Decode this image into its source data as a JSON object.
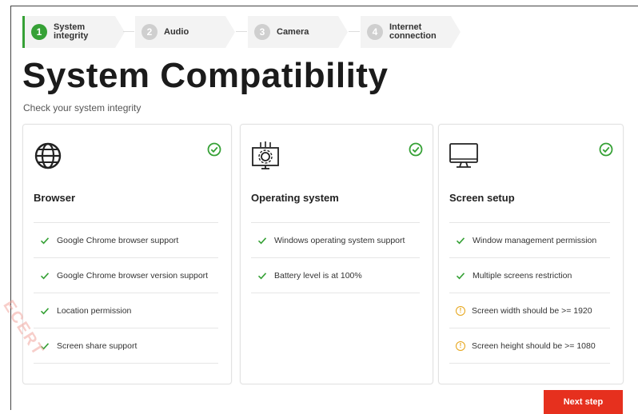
{
  "stepper": {
    "steps": [
      {
        "number": "1",
        "label": "System integrity",
        "active": true
      },
      {
        "number": "2",
        "label": "Audio",
        "active": false
      },
      {
        "number": "3",
        "label": "Camera",
        "active": false
      },
      {
        "number": "4",
        "label": "Internet connection",
        "active": false
      }
    ]
  },
  "page": {
    "title": "System Compatibility",
    "subtitle": "Check your system integrity"
  },
  "cards": [
    {
      "title": "Browser",
      "icon": "globe-icon",
      "status": "ok",
      "items": [
        {
          "text": "Google Chrome browser support",
          "status": "ok"
        },
        {
          "text": "Google Chrome browser version support",
          "status": "ok"
        },
        {
          "text": "Location permission",
          "status": "ok"
        },
        {
          "text": "Screen share support",
          "status": "ok"
        }
      ]
    },
    {
      "title": "Operating system",
      "icon": "os-gear-icon",
      "status": "ok",
      "items": [
        {
          "text": "Windows operating system support",
          "status": "ok"
        },
        {
          "text": "Battery level is at 100%",
          "status": "ok"
        }
      ]
    },
    {
      "title": "Screen setup",
      "icon": "monitor-icon",
      "status": "ok",
      "items": [
        {
          "text": "Window management permission",
          "status": "ok"
        },
        {
          "text": "Multiple screens restriction",
          "status": "ok"
        },
        {
          "text": "Screen width should be >= 1920",
          "status": "warning"
        },
        {
          "text": "Screen height should be >= 1080",
          "status": "warning"
        }
      ]
    }
  ],
  "actions": {
    "next_label": "Next step"
  },
  "watermark": "ECERT",
  "colors": {
    "accent_green": "#36a136",
    "warning": "#e6a417",
    "primary_button": "#e6301e"
  }
}
